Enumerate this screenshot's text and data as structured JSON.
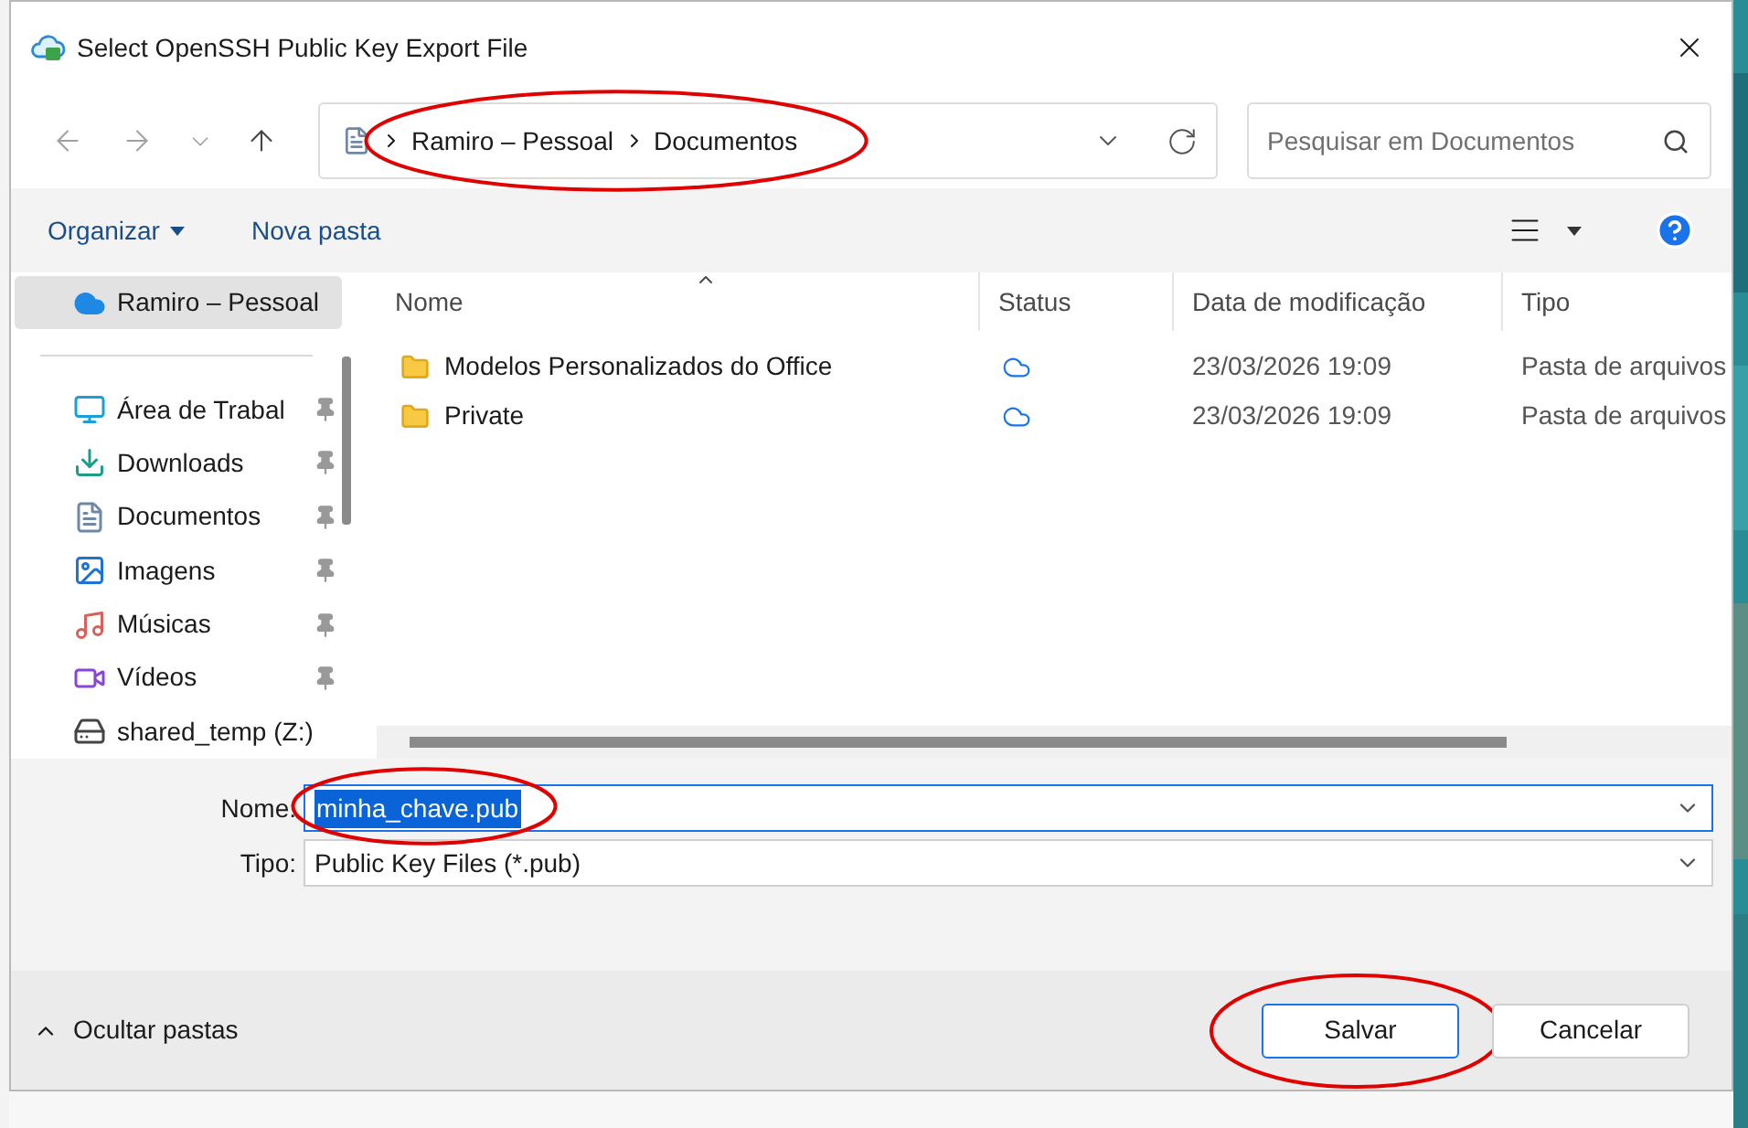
{
  "window": {
    "title": "Select OpenSSH Public Key Export File"
  },
  "address": {
    "crumbs": [
      "Ramiro – Pessoal",
      "Documentos"
    ],
    "highlighted": true
  },
  "search": {
    "placeholder": "Pesquisar em Documentos"
  },
  "toolbar": {
    "organize": "Organizar",
    "new_folder": "Nova pasta"
  },
  "sidebar": {
    "items": [
      {
        "label": "Ramiro – Pessoal",
        "kind": "onedrive",
        "pinned": false,
        "selected": true
      },
      {
        "label": "Área de Trabal",
        "kind": "desktop",
        "pinned": true,
        "selected": false
      },
      {
        "label": "Downloads",
        "kind": "downloads",
        "pinned": true,
        "selected": false
      },
      {
        "label": "Documentos",
        "kind": "documents",
        "pinned": true,
        "selected": false
      },
      {
        "label": "Imagens",
        "kind": "pictures",
        "pinned": true,
        "selected": false
      },
      {
        "label": "Músicas",
        "kind": "music",
        "pinned": true,
        "selected": false
      },
      {
        "label": "Vídeos",
        "kind": "videos",
        "pinned": true,
        "selected": false
      },
      {
        "label": "shared_temp (Z:)",
        "kind": "drive",
        "pinned": false,
        "selected": false
      }
    ]
  },
  "table": {
    "columns": [
      "Nome",
      "Status",
      "Data de modificação",
      "Tipo"
    ],
    "rows": [
      {
        "name": "Modelos Personalizados do Office",
        "modified": "23/03/2026 19:09",
        "type": "Pasta de arquivos"
      },
      {
        "name": "Private",
        "modified": "23/03/2026 19:09",
        "type": "Pasta de arquivos"
      }
    ]
  },
  "filename": {
    "label": "Nome:",
    "value": "minha_chave.pub",
    "highlighted": true
  },
  "filetype": {
    "label": "Tipo:",
    "value": "Public Key Files (*.pub)"
  },
  "footer": {
    "hide_folders": "Ocultar pastas"
  },
  "buttons": [
    {
      "label": "Salvar",
      "kind": "primary",
      "highlighted": true
    },
    {
      "label": "Cancelar",
      "kind": "secondary",
      "highlighted": false
    }
  ]
}
